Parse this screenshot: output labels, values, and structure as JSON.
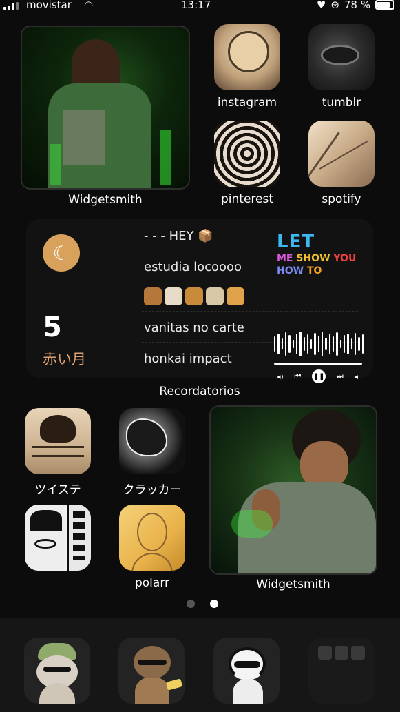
{
  "status_bar": {
    "carrier": "movistar",
    "time": "13:17",
    "battery": "78 %"
  },
  "top_widget": {
    "label": "Widgetsmith"
  },
  "apps": {
    "instagram": "instagram",
    "tumblr": "tumblr",
    "pinterest": "pinterest",
    "spotify": "spotify",
    "twisted": "ツイステ",
    "cracker": "クラッカー",
    "polarr": "polarr",
    "manga": ""
  },
  "reminders_widget": {
    "date_number": "5",
    "month": "赤い月",
    "items": [
      "- - - HEY 📦",
      "estudia locoooo",
      "vanitas no carte",
      "honkai impact"
    ],
    "music": {
      "line1": "LET",
      "line2a": "ME ",
      "line2b": "SHOW ",
      "line2c": "YOU",
      "line3a": "HOW ",
      "line3b": "TO"
    },
    "title": "Recordatorios"
  },
  "bottom_widget": {
    "label": "Widgetsmith"
  },
  "page_dots": {
    "count": 2,
    "active": 1
  },
  "colors": {
    "background": "#0c0c0c",
    "moon": "#d8a25c",
    "month": "#e0a070",
    "let": "#3bb8f0"
  },
  "icons": [
    "signal-icon",
    "wifi-icon",
    "heart-icon",
    "rotation-lock-icon",
    "battery-icon",
    "moon-icon",
    "previous-icon",
    "play-icon",
    "next-icon",
    "volume-icon"
  ]
}
